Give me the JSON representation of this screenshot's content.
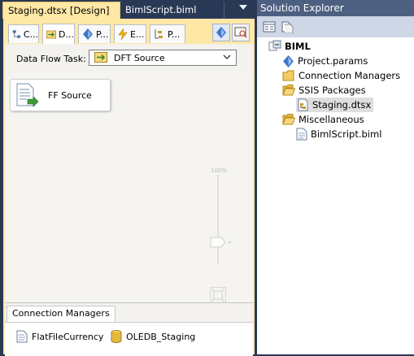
{
  "doc_tabs": [
    {
      "label": "Staging.dtsx [Design]",
      "active": true
    },
    {
      "label": "BimlScript.biml",
      "active": false
    }
  ],
  "designer_tabs": [
    {
      "label": "C...",
      "icon": "control-flow-icon",
      "active": false
    },
    {
      "label": "D...",
      "icon": "data-flow-icon",
      "active": true
    },
    {
      "label": "P...",
      "icon": "parameters-icon",
      "active": false
    },
    {
      "label": "E...",
      "icon": "event-handlers-icon",
      "active": false
    },
    {
      "label": "P...",
      "icon": "package-explorer-icon",
      "active": false
    }
  ],
  "data_flow_task": {
    "label": "Data Flow Task:",
    "selected": "DFT Source"
  },
  "canvas": {
    "component_label": "FF Source",
    "zoom_label": "100%"
  },
  "connection_managers": {
    "tab_label": "Connection Managers",
    "items": [
      {
        "label": "FlatFileCurrency",
        "icon": "flat-file-icon"
      },
      {
        "label": "OLEDB_Staging",
        "icon": "database-icon"
      }
    ]
  },
  "solution_explorer": {
    "title": "Solution Explorer",
    "project": "BIML",
    "items": {
      "project_params": "Project.params",
      "connection_managers": "Connection Managers",
      "ssis_packages": "SSIS Packages",
      "staging": "Staging.dtsx",
      "miscellaneous": "Miscellaneous",
      "bimlscript": "BimlScript.biml"
    }
  },
  "colors": {
    "frame": "#293955",
    "active_tab": "#ffe8a6",
    "se_title": "#4d6082",
    "canvas": "#f5f4f0"
  }
}
